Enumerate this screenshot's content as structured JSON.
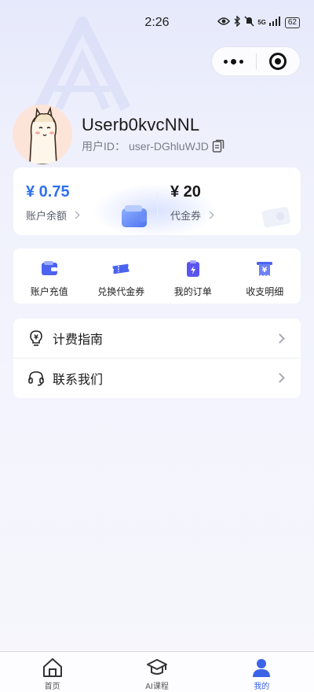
{
  "status_bar": {
    "time": "2:26",
    "network": "5G",
    "battery": "62"
  },
  "capsule": {
    "more_icon": "more-dots-icon",
    "close_icon": "target-icon"
  },
  "profile": {
    "username": "Userb0kvcNNL",
    "user_id_label": "用户ID：",
    "user_id": "user-DGhluWJD",
    "avatar_icon": "alpaca-avatar"
  },
  "wallet": {
    "balance_amount": "¥ 0.75",
    "balance_label": "账户余额",
    "voucher_amount": "¥ 20",
    "voucher_label": "代金券",
    "accent_color": "#2f6ff0"
  },
  "actions": [
    {
      "label": "账户充值",
      "icon": "wallet-icon"
    },
    {
      "label": "兑换代金券",
      "icon": "ticket-icon"
    },
    {
      "label": "我的订单",
      "icon": "order-icon"
    },
    {
      "label": "收支明细",
      "icon": "yuan-receipt-icon"
    }
  ],
  "menu": [
    {
      "label": "计费指南",
      "icon": "bulb-yuan-icon"
    },
    {
      "label": "联系我们",
      "icon": "headset-icon"
    }
  ],
  "tabbar": [
    {
      "label": "首页",
      "icon": "home-icon",
      "active": false
    },
    {
      "label": "AI课程",
      "icon": "graduation-cap-icon",
      "active": false
    },
    {
      "label": "我的",
      "icon": "user-icon",
      "active": true
    }
  ]
}
